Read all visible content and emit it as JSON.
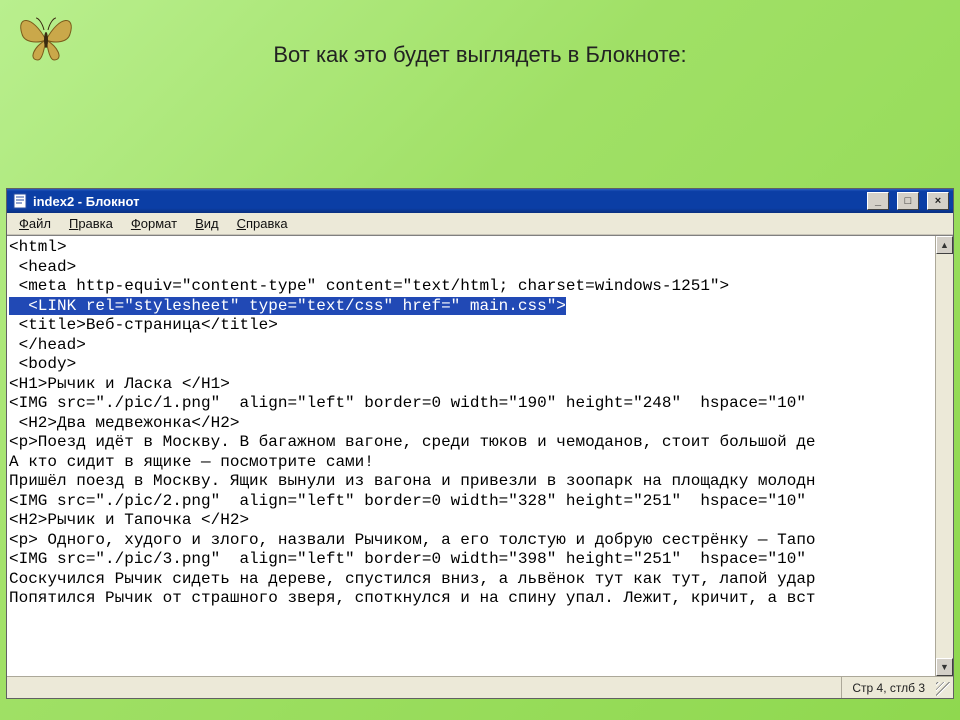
{
  "slide": {
    "title": "Вот как это будет выглядеть в Блокноте:"
  },
  "window": {
    "title": "index2 - Блокнот",
    "minimize": "_",
    "maximize": "□",
    "close": "×"
  },
  "menu": {
    "file": "Файл",
    "edit": "Правка",
    "format": "Формат",
    "view": "Вид",
    "help": "Справка"
  },
  "content": {
    "lines": [
      "<html>",
      " <head>",
      " <meta http-equiv=\"content-type\" content=\"text/html; charset=windows-1251\">",
      "  <LINK rel=\"stylesheet\" type=\"text/css\" href=\" main.css\">",
      " <title>Веб-страница</title>",
      " </head>",
      " <body>",
      "<H1>Рычик и Ласка </H1>",
      "<IMG src=\"./pic/1.png\"  align=\"left\" border=0 width=\"190\" height=\"248\"  hspace=\"10\" ",
      " <H2>Два медвежонка</H2>",
      "<p>Поезд идёт в Москву. В багажном вагоне, среди тюков и чемоданов, стоит большой де",
      "А кто сидит в ящике — посмотрите сами!",
      "Пришёл поезд в Москву. Ящик вынули из вагона и привезли в зоопарк на площадку молодн",
      "",
      "<IMG src=\"./pic/2.png\"  align=\"left\" border=0 width=\"328\" height=\"251\"  hspace=\"10\" ",
      "<H2>Рычик и Тапочка </H2>",
      "<p> Одного, худого и злого, назвали Рычиком, а его толстую и добрую сестрёнку — Тапо",
      "<IMG src=\"./pic/3.png\"  align=\"left\" border=0 width=\"398\" height=\"251\"  hspace=\"10\" ",
      "Соскучился Рычик сидеть на дереве, спустился вниз, а львёнок тут как тут, лапой удар",
      "Попятился Рычик от страшного зверя, споткнулся и на спину упал. Лежит, кричит, а вст"
    ],
    "selected_index": 3
  },
  "status": {
    "position": "Стр 4, стлб 3"
  },
  "icons": {
    "butterfly": "butterfly-icon",
    "document": "document-icon"
  }
}
